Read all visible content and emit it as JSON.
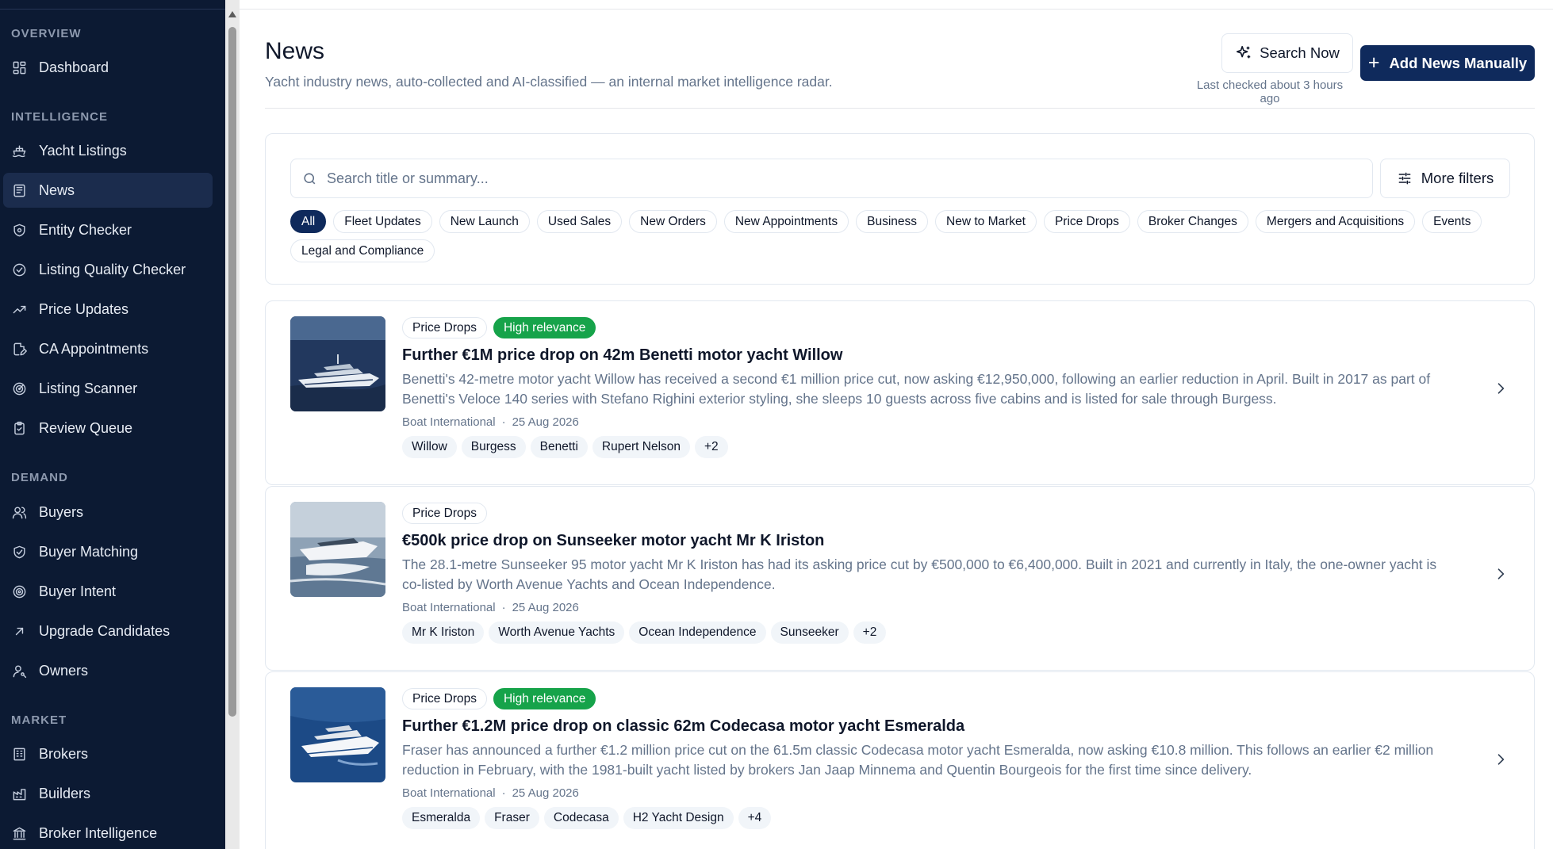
{
  "sidebar": {
    "sections": [
      {
        "title": "OVERVIEW",
        "items": [
          {
            "label": "Dashboard",
            "icon": "dashboard-icon"
          }
        ]
      },
      {
        "title": "INTELLIGENCE",
        "items": [
          {
            "label": "Yacht Listings",
            "icon": "ship-icon"
          },
          {
            "label": "News",
            "icon": "newspaper-icon",
            "active": true
          },
          {
            "label": "Entity Checker",
            "icon": "shield-check-icon"
          },
          {
            "label": "Listing Quality Checker",
            "icon": "circle-check-icon"
          },
          {
            "label": "Price Updates",
            "icon": "trending-up-icon"
          },
          {
            "label": "CA Appointments",
            "icon": "file-edit-icon"
          },
          {
            "label": "Listing Scanner",
            "icon": "radar-icon"
          },
          {
            "label": "Review Queue",
            "icon": "clipboard-check-icon"
          }
        ]
      },
      {
        "title": "DEMAND",
        "items": [
          {
            "label": "Buyers",
            "icon": "users-icon"
          },
          {
            "label": "Buyer Matching",
            "icon": "handshake-icon"
          },
          {
            "label": "Buyer Intent",
            "icon": "target-icon"
          },
          {
            "label": "Upgrade Candidates",
            "icon": "arrow-up-right-icon"
          },
          {
            "label": "Owners",
            "icon": "user-key-icon"
          }
        ]
      },
      {
        "title": "MARKET",
        "items": [
          {
            "label": "Brokers",
            "icon": "building-icon"
          },
          {
            "label": "Builders",
            "icon": "factory-icon"
          },
          {
            "label": "Broker Intelligence",
            "icon": "landmark-icon"
          }
        ]
      }
    ]
  },
  "header": {
    "title": "News",
    "subtitle": "Yacht industry news, auto-collected and AI-classified — an internal market intelligence radar.",
    "search_now_label": "Search Now",
    "last_checked": "Last checked about 3 hours ago",
    "add_news_label": "Add News Manually"
  },
  "filters": {
    "search_placeholder": "Search title or summary...",
    "more_filters_label": "More filters",
    "categories": [
      "All",
      "Fleet Updates",
      "New Launch",
      "Used Sales",
      "New Orders",
      "New Appointments",
      "Business",
      "New to Market",
      "Price Drops",
      "Broker Changes",
      "Mergers and Acquisitions",
      "Events",
      "Legal and Compliance"
    ],
    "active_category": "All"
  },
  "news": [
    {
      "category": "Price Drops",
      "relevance": "High relevance",
      "title": "Further €1M price drop on 42m Benetti motor yacht Willow",
      "summary": "Benetti's 42-metre motor yacht Willow has received a second €1 million price cut, now asking €12,950,000, following an earlier reduction in April. Built in 2017 as part of Benetti's Veloce 140 series with Stefano Righini exterior styling, she sleeps 10 guests across five cabins and is listed for sale through Burgess.",
      "source": "Boat International",
      "date": "25 Aug 2026",
      "tags": [
        "Willow",
        "Burgess",
        "Benetti",
        "Rupert Nelson",
        "+2"
      ]
    },
    {
      "category": "Price Drops",
      "relevance": "",
      "title": "€500k price drop on Sunseeker motor yacht Mr K Iriston",
      "summary": "The 28.1-metre Sunseeker 95 motor yacht Mr K Iriston has had its asking price cut by €500,000 to €6,400,000. Built in 2021 and currently in Italy, the one-owner yacht is co-listed by Worth Avenue Yachts and Ocean Independence.",
      "source": "Boat International",
      "date": "25 Aug 2026",
      "tags": [
        "Mr K Iriston",
        "Worth Avenue Yachts",
        "Ocean Independence",
        "Sunseeker",
        "+2"
      ]
    },
    {
      "category": "Price Drops",
      "relevance": "High relevance",
      "title": "Further €1.2M price drop on classic 62m Codecasa motor yacht Esmeralda",
      "summary": "Fraser has announced a further €1.2 million price cut on the 61.5m classic Codecasa motor yacht Esmeralda, now asking €10.8 million. This follows an earlier €2 million reduction in February, with the 1981-built yacht listed by brokers Jan Jaap Minnema and Quentin Bourgeois for the first time since delivery.",
      "source": "Boat International",
      "date": "25 Aug 2026",
      "tags": [
        "Esmeralda",
        "Fraser",
        "Codecasa",
        "H2 Yacht Design",
        "+4"
      ]
    }
  ],
  "colors": {
    "sidebar_bg": "#0c1a33",
    "primary": "#0f2a5c",
    "relevance_green": "#16a34a",
    "muted_text": "#64748b"
  }
}
